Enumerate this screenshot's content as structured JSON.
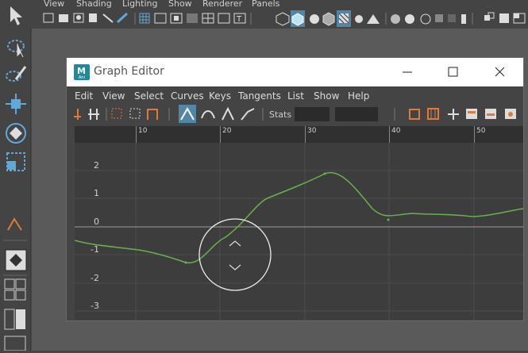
{
  "main_menu": {
    "view": "View",
    "shading": "Shading",
    "lighting": "Lighting",
    "show": "Show",
    "renderer": "Renderer",
    "panels": "Panels"
  },
  "graph_editor": {
    "title": "Graph Editor",
    "app_logo": "M",
    "app_logo_sub": "Ani",
    "menus": [
      "Edit",
      "View",
      "Select",
      "Curves",
      "Keys",
      "Tangents",
      "List",
      "Show",
      "Help"
    ],
    "stats_label": "Stats",
    "stats_value_1": "",
    "stats_value_2": "",
    "time_ticks": [
      "10",
      "20",
      "30",
      "40",
      "50"
    ],
    "value_ticks": [
      "2",
      "1",
      "0",
      "-1",
      "-2",
      "-3"
    ]
  },
  "colors": {
    "curve": "#6ab04c",
    "accent": "#5285a6",
    "toolbar_orange": "#e07a3a"
  },
  "icons": {
    "minimize": "minimize-icon",
    "maximize": "maximize-icon",
    "close": "close-icon",
    "scroll_up": "chevron-up-icon",
    "scroll_down": "chevron-down-icon"
  }
}
